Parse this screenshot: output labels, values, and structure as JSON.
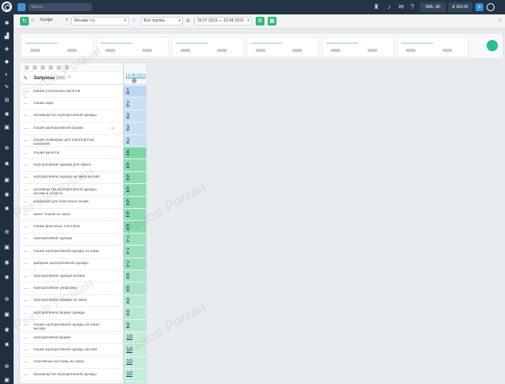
{
  "topbar": {
    "project_name": "Site.ru",
    "xml_label": "XML: 90",
    "ip_label": "₽ 164.42"
  },
  "toolbar": {
    "search_engine": "Google",
    "region": "Москва / ru",
    "groups": "Все группы",
    "date_range": "20.07.2019 — 20.08.2019"
  },
  "table": {
    "header_title": "Запросы",
    "header_count": "(165)",
    "date_header": "14.08.2019",
    "rows": [
      {
        "q": "пошив утепленных жилетов",
        "fr": "",
        "pos": "1",
        "color": "#bcd8f0"
      },
      {
        "q": "пошив кофт",
        "fr": "",
        "pos": "2",
        "color": "#c7e0f3"
      },
      {
        "q": "производство корпоративной одежды",
        "fr": "",
        "pos": "3",
        "color": "#c7e0f3"
      },
      {
        "q": "пошив корпоративной формы",
        "fr": "30",
        "pos": "3",
        "color": "#c7e0f3"
      },
      {
        "q": "пошив униформы для транспортных компаний",
        "fr": "",
        "pos": "3",
        "color": "#c7e0f3"
      },
      {
        "q": "пошив жилетов",
        "fr": "",
        "pos": "4",
        "color": "#7fd6a5"
      },
      {
        "q": "корпоративная одежда для офиса",
        "fr": "",
        "pos": "6",
        "color": "#8ddcb0"
      },
      {
        "q": "корпоративная одежда на заказ москва",
        "fr": "",
        "pos": "6",
        "color": "#8ddcb0"
      },
      {
        "q": "производство корпоративной одежды москва и области",
        "fr": "",
        "pos": "6",
        "color": "#8ddcb0"
      },
      {
        "q": "униформа для персонала пошив",
        "fr": "",
        "pos": "6",
        "color": "#8ddcb0"
      },
      {
        "q": "жилет пошив на заказ",
        "fr": "",
        "pos": "6",
        "color": "#8ddcb0"
      },
      {
        "q": "пошив флисовых толстовок",
        "fr": "",
        "pos": "6",
        "color": "#8ddcb0"
      },
      {
        "q": "корпоративная одежда",
        "fr": "",
        "pos": "7",
        "color": "#9be0bb"
      },
      {
        "q": "пошив корпоративной одежды на заказ",
        "fr": "",
        "pos": "7",
        "color": "#9be0bb"
      },
      {
        "q": "фабрика корпоративной одежды",
        "fr": "",
        "pos": "7",
        "color": "#9be0bb"
      },
      {
        "q": "корпоративная одежда москва",
        "fr": "",
        "pos": "8",
        "color": "#a9e5c6"
      },
      {
        "q": "корпоративная униформа",
        "fr": "",
        "pos": "8",
        "color": "#a9e5c6"
      },
      {
        "q": "корпоративная одежда на заказ",
        "fr": "",
        "pos": "9",
        "color": "#b6e9cf"
      },
      {
        "q": "корпоративная форма одежды",
        "fr": "",
        "pos": "9",
        "color": "#b6e9cf"
      },
      {
        "q": "пошив корпоративной одежды на заказ москва",
        "fr": "",
        "pos": "9",
        "color": "#b6e9cf"
      },
      {
        "q": "корпоративная форма",
        "fr": "",
        "pos": "10",
        "color": "#c4eed8"
      },
      {
        "q": "пошив корпоративной одежды москва",
        "fr": "",
        "pos": "10",
        "color": "#c4eed8"
      },
      {
        "q": "спортивные костюмы на заказ",
        "fr": "",
        "pos": "10",
        "color": "#c4eed8"
      },
      {
        "q": "производство корпоративной одежды",
        "fr": "",
        "pos": "10",
        "color": "#c4eed8"
      },
      {
        "q": "",
        "fr": "",
        "pos": "",
        "color": "#c4eed8"
      }
    ]
  },
  "watermark": "Раков Роман",
  "colors": {
    "accent": "#32b67a",
    "topbar": "#243447",
    "sidebar": "#1f2f40"
  }
}
